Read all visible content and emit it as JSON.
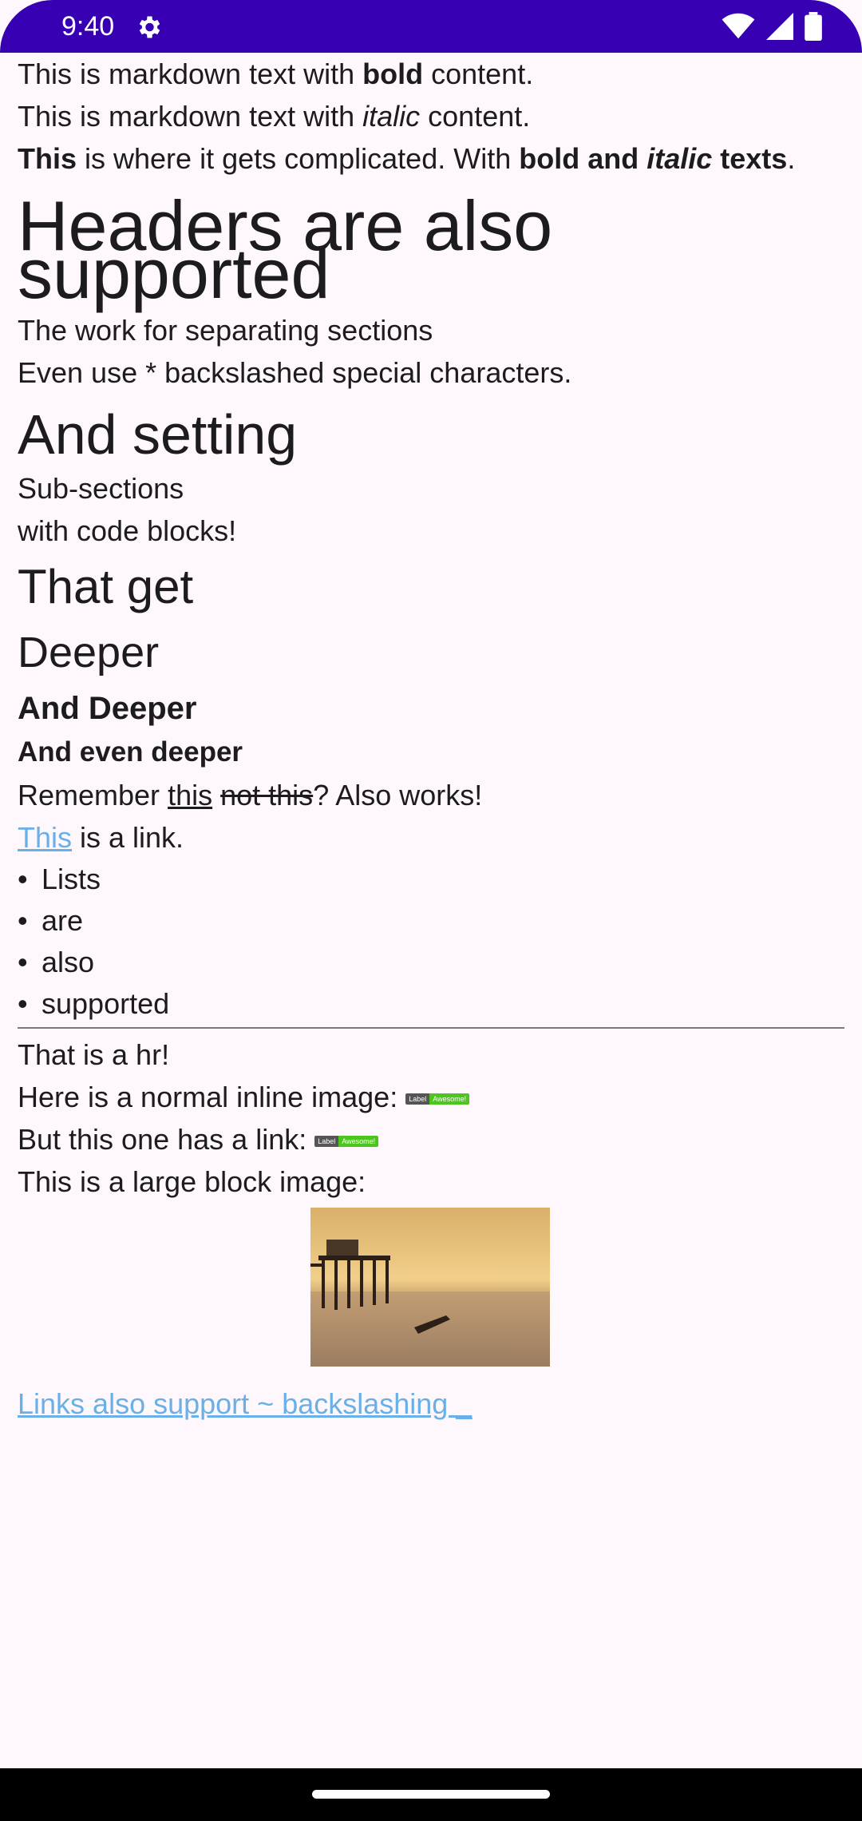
{
  "status": {
    "time": "9:40"
  },
  "content": {
    "l1": {
      "a": "This is markdown text with ",
      "b": "bold",
      "c": " content."
    },
    "l2": {
      "a": "This is markdown text with ",
      "b": "italic",
      "c": " content."
    },
    "l3": {
      "a": "This",
      "b": " is where it gets complicated. With ",
      "c": "bold and ",
      "d": "italic",
      "e": "texts",
      "f": "."
    },
    "h1": "Headers are also supported",
    "l4": "The work for separating sections",
    "l5": "Even use * backslashed special characters.",
    "h2": "And setting",
    "l6": "Sub-sections",
    "l7": "with code blocks!",
    "h3": "That get",
    "h4": "Deeper",
    "h5": "And Deeper",
    "h6": "And even deeper",
    "l8": {
      "a": "Remember ",
      "b": "this",
      "c": " ",
      "d": "not this",
      "e": "? Also works!"
    },
    "l9": {
      "link": "This",
      "rest": " is a link."
    },
    "bullets": [
      "Lists",
      "are",
      "also",
      "supported"
    ],
    "bullet_char": "•",
    "l10": "That is a hr!",
    "l11": "Here is a normal inline image:",
    "l12": "But this one has a link:",
    "badge": {
      "left": "Label",
      "right": "Awesome!"
    },
    "l13": "This is a large block image:",
    "l14": "Links also support ~ backslashing _"
  },
  "colors": {
    "status_bar": "#3700b3",
    "link": "#6ab0e8",
    "background": "#fef7fb",
    "badge_right": "#4cc61e"
  }
}
